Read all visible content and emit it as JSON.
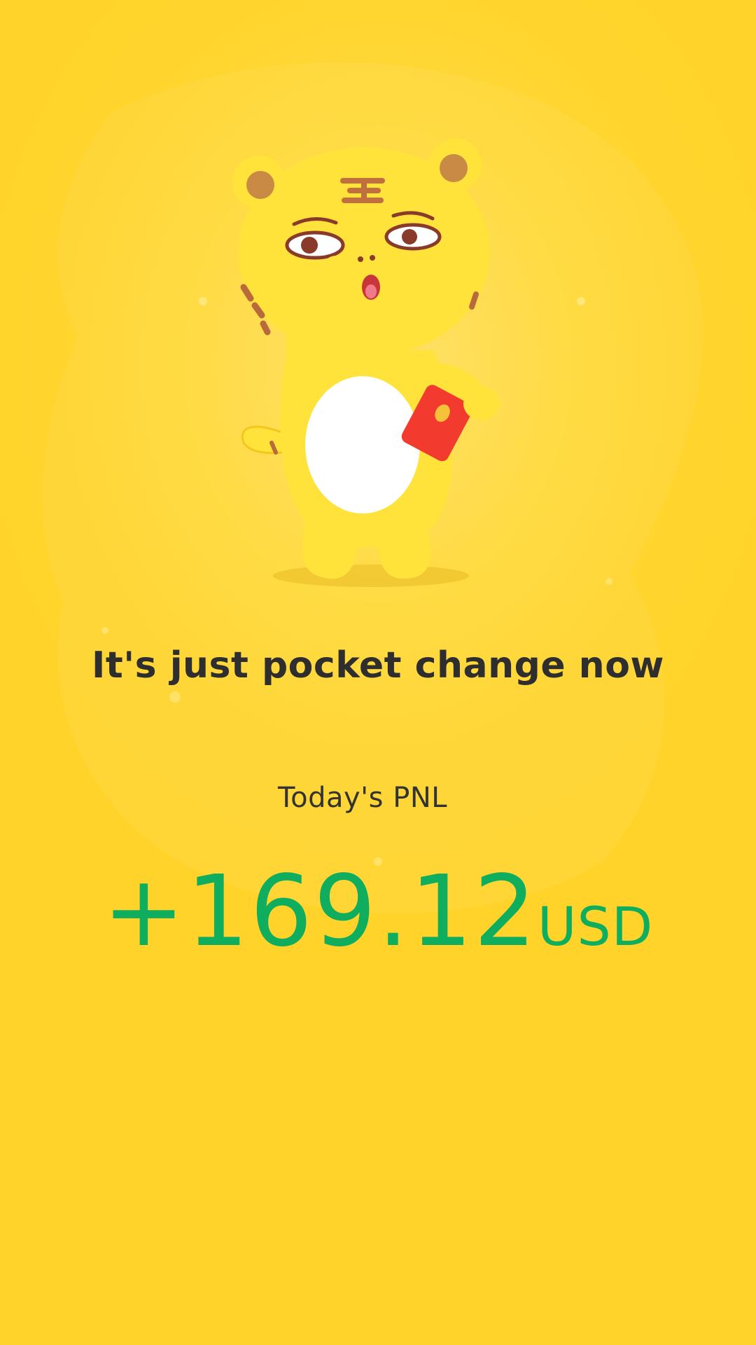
{
  "screen": {
    "background_color": "#FFD42C",
    "accent_color": "#0FAE5F",
    "text_color": "#2E2E2E"
  },
  "mascot": {
    "icon": "tiger-mascot-icon",
    "holding": "red-envelope-icon"
  },
  "headline": "It's just pocket change now",
  "pnl": {
    "label": "Today's PNL",
    "value": "+169.12",
    "unit": "USD"
  }
}
